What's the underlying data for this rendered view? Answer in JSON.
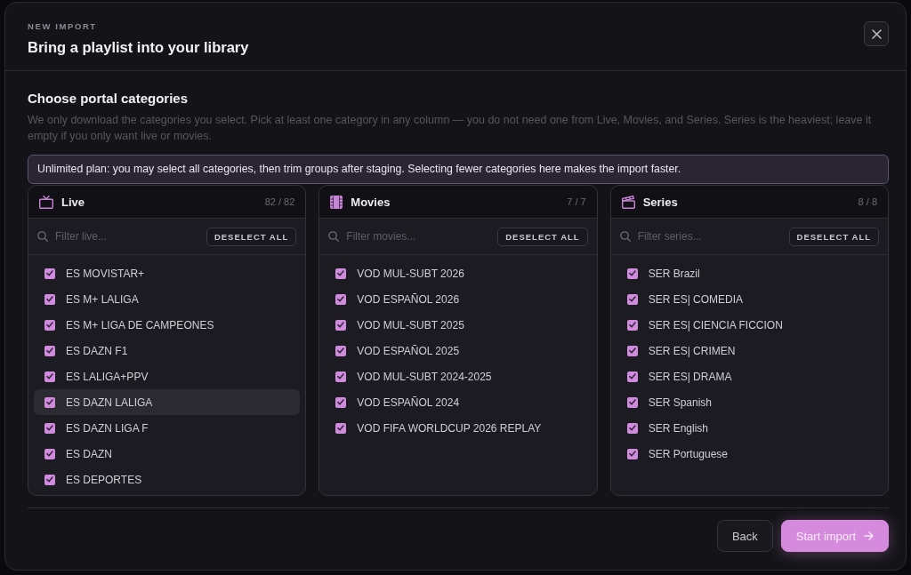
{
  "header": {
    "eyebrow": "NEW IMPORT",
    "title": "Bring a playlist into your library"
  },
  "section": {
    "title": "Choose portal categories",
    "description": "We only download the categories you select. Pick at least one category in any column — you do not need one from Live, Movies, and Series. Series is the heaviest; leave it empty if you only want live or movies.",
    "notice": "Unlimited plan: you may select all categories, then trim groups after staging. Selecting fewer categories here makes the import faster."
  },
  "columns": [
    {
      "kind": "live",
      "title": "Live",
      "count": "82 / 82",
      "filter_placeholder": "Filter live...",
      "action": "DESELECT ALL",
      "items": [
        {
          "label": "ES MOVISTAR+",
          "checked": true,
          "highlighted": false
        },
        {
          "label": "ES M+ LALIGA",
          "checked": true,
          "highlighted": false
        },
        {
          "label": "ES M+ LIGA DE CAMPEONES",
          "checked": true,
          "highlighted": false
        },
        {
          "label": "ES DAZN F1",
          "checked": true,
          "highlighted": false
        },
        {
          "label": "ES LALIGA+PPV",
          "checked": true,
          "highlighted": false
        },
        {
          "label": "ES DAZN LALIGA",
          "checked": true,
          "highlighted": true
        },
        {
          "label": "ES DAZN LIGA F",
          "checked": true,
          "highlighted": false
        },
        {
          "label": "ES DAZN",
          "checked": true,
          "highlighted": false
        },
        {
          "label": "ES DEPORTES",
          "checked": true,
          "highlighted": false
        }
      ]
    },
    {
      "kind": "movies",
      "title": "Movies",
      "count": "7 / 7",
      "filter_placeholder": "Filter movies...",
      "action": "DESELECT ALL",
      "items": [
        {
          "label": "VOD MUL-SUBT 2026",
          "checked": true,
          "highlighted": false
        },
        {
          "label": "VOD ESPAÑOL 2026",
          "checked": true,
          "highlighted": false
        },
        {
          "label": "VOD MUL-SUBT 2025",
          "checked": true,
          "highlighted": false
        },
        {
          "label": "VOD ESPAÑOL 2025",
          "checked": true,
          "highlighted": false
        },
        {
          "label": "VOD MUL-SUBT 2024-2025",
          "checked": true,
          "highlighted": false
        },
        {
          "label": "VOD ESPAÑOL 2024",
          "checked": true,
          "highlighted": false
        },
        {
          "label": "VOD FIFA WORLDCUP 2026 REPLAY",
          "checked": true,
          "highlighted": false
        }
      ]
    },
    {
      "kind": "series",
      "title": "Series",
      "count": "8 / 8",
      "filter_placeholder": "Filter series...",
      "action": "DESELECT ALL",
      "items": [
        {
          "label": "SER Brazil",
          "checked": true,
          "highlighted": false
        },
        {
          "label": "SER ES| COMEDIA",
          "checked": true,
          "highlighted": false
        },
        {
          "label": "SER ES| CIENCIA FICCION",
          "checked": true,
          "highlighted": false
        },
        {
          "label": "SER ES| CRIMEN",
          "checked": true,
          "highlighted": false
        },
        {
          "label": "SER ES| DRAMA",
          "checked": true,
          "highlighted": false
        },
        {
          "label": "SER Spanish",
          "checked": true,
          "highlighted": false
        },
        {
          "label": "SER English",
          "checked": true,
          "highlighted": false
        },
        {
          "label": "SER Portuguese",
          "checked": true,
          "highlighted": false
        }
      ]
    }
  ],
  "footer": {
    "buttons": [
      {
        "kind": "secondary",
        "label": "Back"
      },
      {
        "kind": "primary",
        "label": "Start import"
      }
    ]
  }
}
